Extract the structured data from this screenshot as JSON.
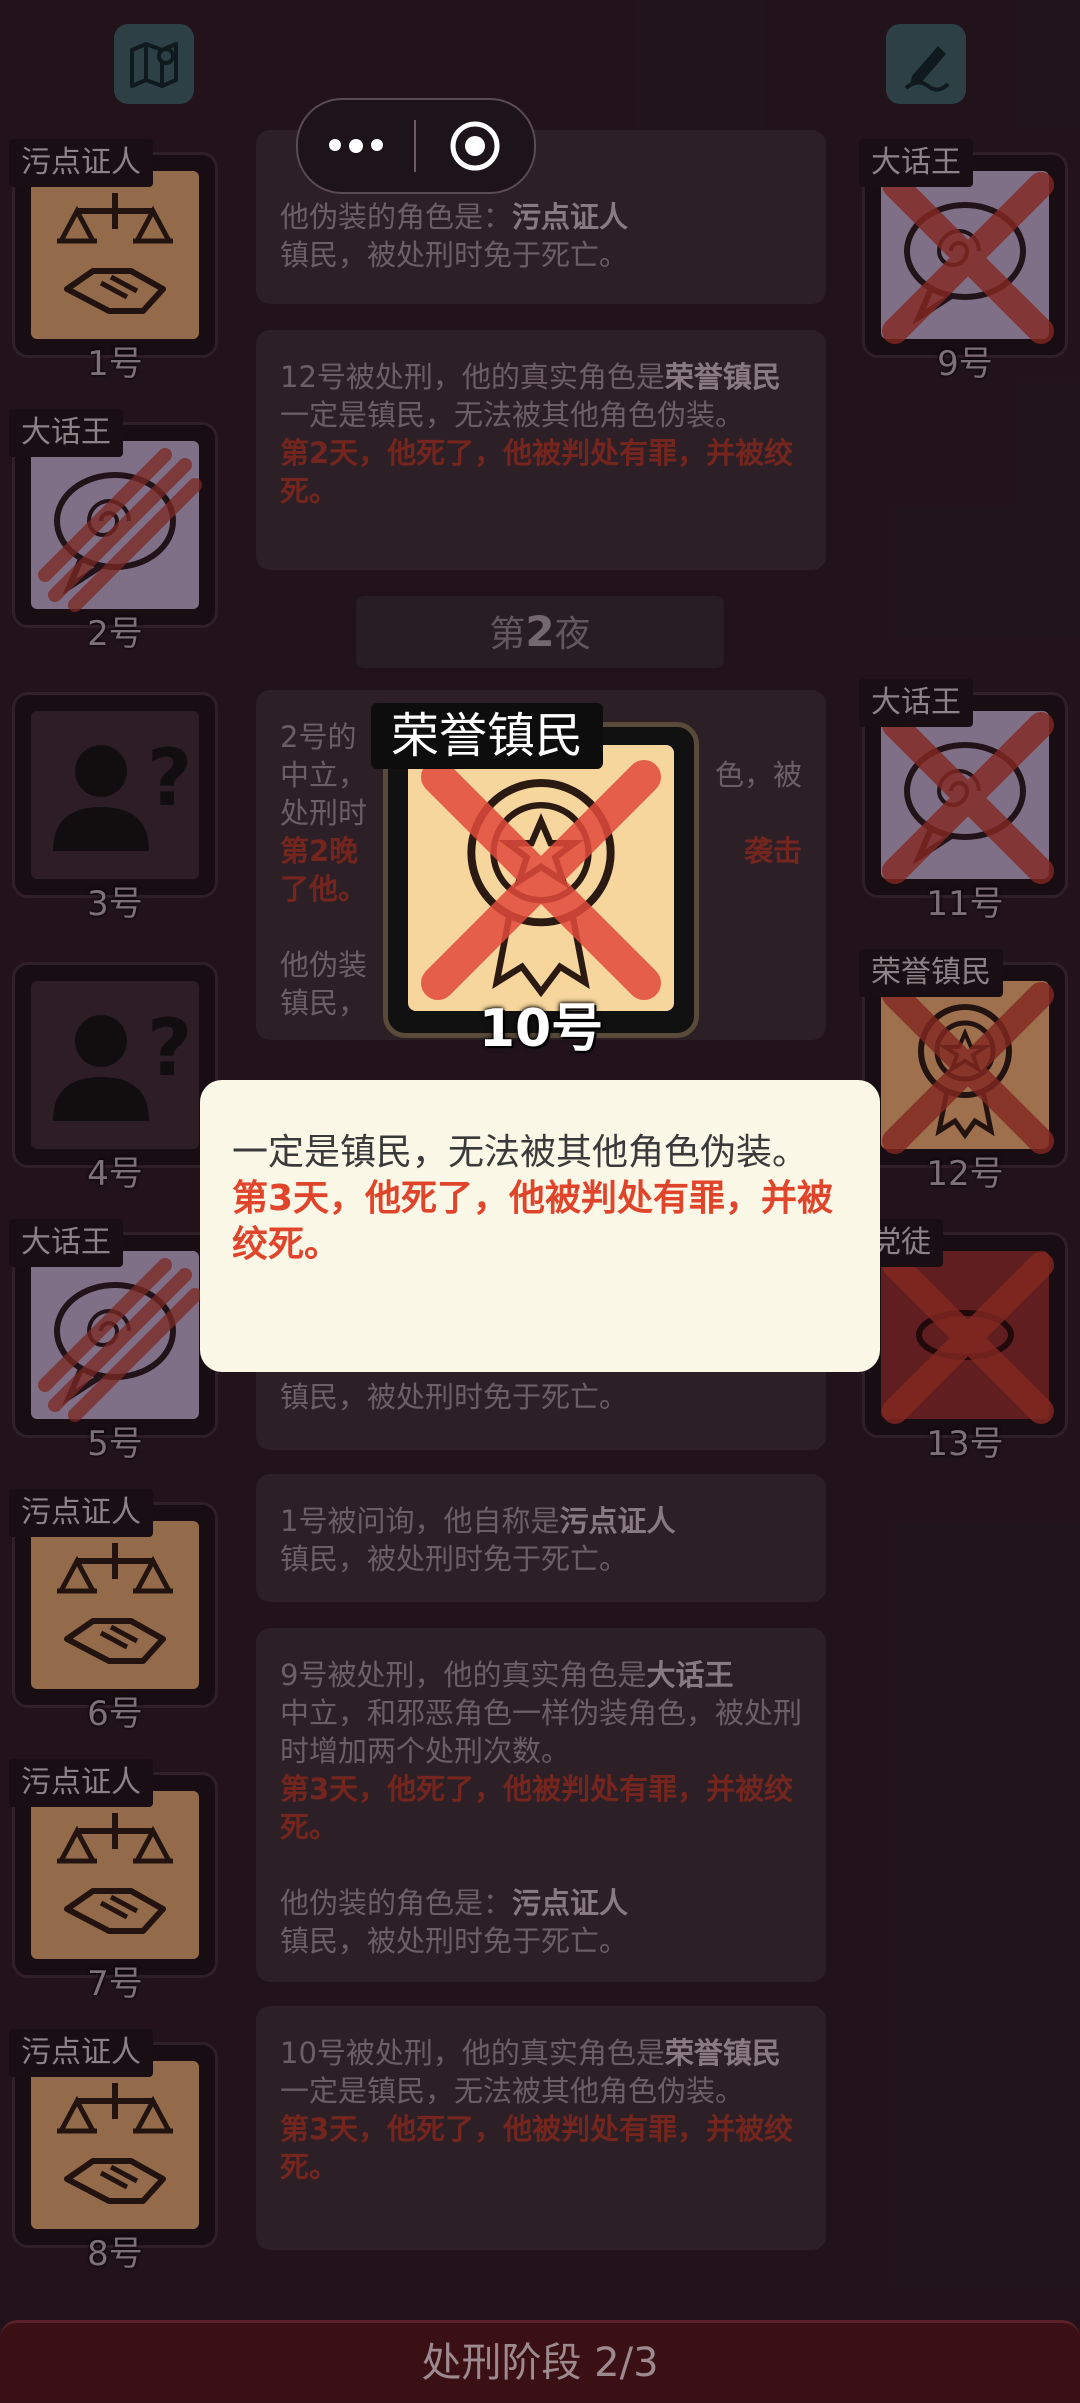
{
  "cards": [
    {
      "tag": "污点证人",
      "num": "1号"
    },
    {
      "tag": "大话王",
      "num": "2号"
    },
    {
      "tag": "",
      "num": "3号"
    },
    {
      "tag": "",
      "num": "4号"
    },
    {
      "tag": "大话王",
      "num": "5号"
    },
    {
      "tag": "污点证人",
      "num": "6号"
    },
    {
      "tag": "污点证人",
      "num": "7号"
    },
    {
      "tag": "污点证人",
      "num": "8号"
    },
    {
      "tag": "大话王",
      "num": "9号"
    },
    {
      "tag": "大话王",
      "num": "11号"
    },
    {
      "tag": "荣誉镇民",
      "num": "12号"
    },
    {
      "tag": "党徒",
      "num": "13号"
    }
  ],
  "log": [
    {
      "l1a": "他伪装的角色是：",
      "l1b": "污点证人",
      "l2": "镇民，被处刑时免于死亡。"
    },
    {
      "l1a": "12号被处刑，他的真实角色是",
      "l1b": "荣誉镇民",
      "l2": "一定是镇民，无法被其他角色伪装。",
      "red": "第2天，他死了，他被判处有罪，并被绞死。"
    },
    {
      "l1": "2号的",
      "l2": "中立，",
      "l2b": "色，被",
      "l3": "处刑时",
      "red1": "第2晚",
      "red1b": "袭击",
      "red2": "了他。",
      "l4": "他伪装",
      "l5": "镇民，"
    },
    {
      "l1": "镇民，被处刑时免于死亡。"
    },
    {
      "l1a": "1号被问询，他自称是",
      "l1b": "污点证人",
      "l2": "镇民，被处刑时免于死亡。"
    },
    {
      "l1a": "9号被处刑，他的真实角色是",
      "l1b": "大话王",
      "l2": "中立，和邪恶角色一样伪装角色，被处刑时增加两个处刑次数。",
      "red": "第3天，他死了，他被判处有罪，并被绞死。",
      "l3a": "他伪装的角色是：",
      "l3b": "污点证人",
      "l4": "镇民，被处刑时免于死亡。"
    },
    {
      "l1a": "10号被处刑，他的真实角色是",
      "l1b": "荣誉镇民",
      "l2": "一定是镇民，无法被其他角色伪装。",
      "red": "第3天，他死了，他被判处有罪，并被绞死。"
    }
  ],
  "night": {
    "pre": "第",
    "num": "2",
    "post": "夜"
  },
  "focus": {
    "tag": "荣誉镇民",
    "num": "10号"
  },
  "tooltip": {
    "line": "一定是镇民，无法被其他角色伪装。",
    "red": "第3天，他死了，他被判处有罪，并被绞死。"
  },
  "bottom": {
    "label": "处刑阶段 2/3"
  },
  "icons": {
    "left": "map-icon",
    "right": "notes-icon"
  }
}
